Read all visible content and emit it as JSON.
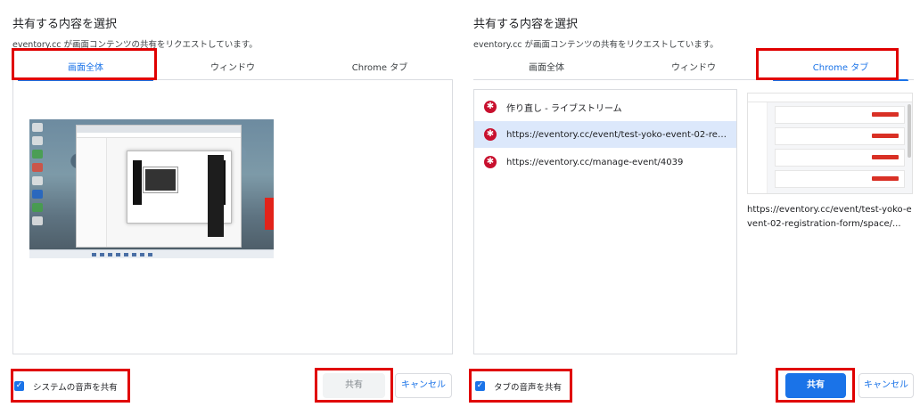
{
  "left": {
    "title": "共有する内容を選択",
    "subtitle": "eventory.cc が画面コンテンツの共有をリクエストしています。",
    "tabs": [
      {
        "label": "画面全体",
        "active": true
      },
      {
        "label": "ウィンドウ",
        "active": false
      },
      {
        "label": "Chrome タブ",
        "active": false
      }
    ],
    "audio_checkbox": {
      "label": "システムの音声を共有",
      "checked": true
    },
    "share_label": "共有",
    "cancel_label": "キャンセル"
  },
  "right": {
    "title": "共有する内容を選択",
    "subtitle": "eventory.cc が画面コンテンツの共有をリクエストしています。",
    "tabs": [
      {
        "label": "画面全体",
        "active": false
      },
      {
        "label": "ウィンドウ",
        "active": false
      },
      {
        "label": "Chrome タブ",
        "active": true
      }
    ],
    "tab_list": [
      {
        "title": "作り直し - ライブストリーム",
        "selected": false
      },
      {
        "title": "https://eventory.cc/event/test-yoko-event-02-registration-form/space/...",
        "selected": true
      },
      {
        "title": "https://eventory.cc/manage-event/4039",
        "selected": false
      }
    ],
    "preview_caption": "https://eventory.cc/event/test-yoko-event-02-registration-form/space/...",
    "audio_checkbox": {
      "label": "タブの音声を共有",
      "checked": true
    },
    "share_label": "共有",
    "cancel_label": "キャンセル"
  },
  "colors": {
    "accent": "#1a73e8",
    "highlight": "#e00000",
    "selected_row": "#dce8fb",
    "favicon": "#c8102e"
  },
  "icons": {
    "favicon": "eventory-favicon-icon",
    "checkbox": "checkbox-checked-icon"
  }
}
